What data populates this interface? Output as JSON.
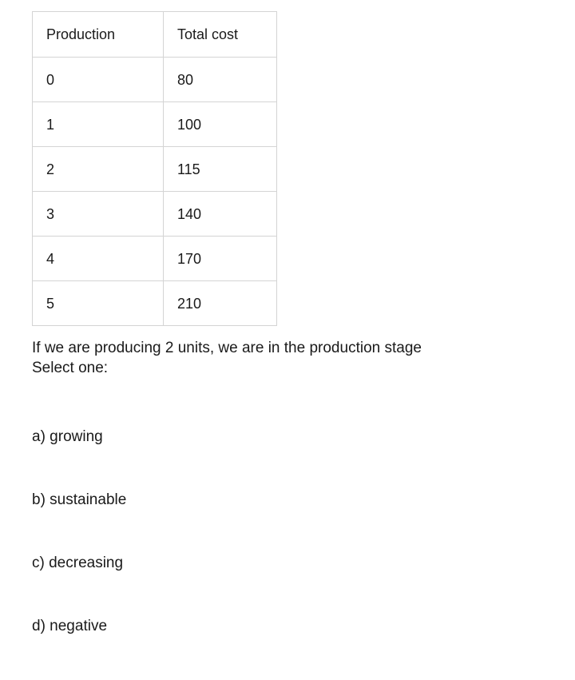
{
  "table": {
    "columns": [
      "Production",
      "Total cost"
    ],
    "rows": [
      [
        "0",
        "80"
      ],
      [
        "1",
        "100"
      ],
      [
        "2",
        "115"
      ],
      [
        "3",
        "140"
      ],
      [
        "4",
        "170"
      ],
      [
        "5",
        "210"
      ]
    ]
  },
  "question": {
    "stem": "If we are producing 2 units, we are in the production stage",
    "instruction": "Select one:",
    "options": [
      {
        "label": "a) growing"
      },
      {
        "label": "b) sustainable"
      },
      {
        "label": "c) decreasing"
      },
      {
        "label": "d) negative"
      }
    ]
  },
  "colors": {
    "text": "#1a1a1a",
    "border": "#d4d4d4",
    "background": "#ffffff"
  }
}
